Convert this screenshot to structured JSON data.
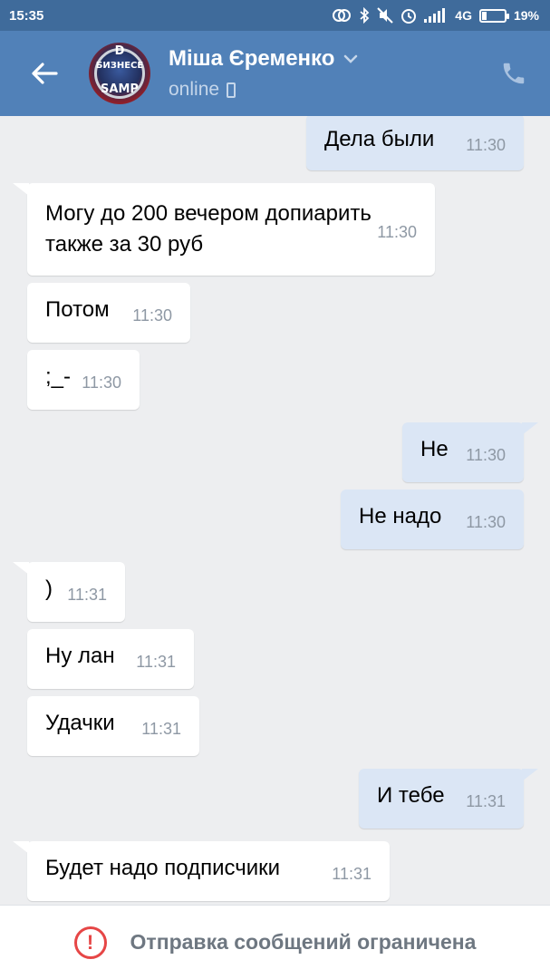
{
  "status_bar": {
    "time": "15:35",
    "network": "4G",
    "battery": "19%",
    "battery_level": 0.19,
    "icons": [
      "sync-icon",
      "bluetooth-icon",
      "mute-icon",
      "alarm-icon",
      "signal-icon",
      "battery-icon"
    ]
  },
  "header": {
    "contact_name": "Міша Єременко",
    "status": "online",
    "avatar_text_top": "D",
    "avatar_text_mid": "БИЗНЕСЕ",
    "avatar_text_bottom": "SAMP",
    "colors": {
      "header": "#5181b8",
      "status_bar": "#3f6b9b"
    }
  },
  "messages": [
    {
      "dir": "out",
      "text": "Дела были",
      "time": "11:30"
    },
    {
      "dir": "in",
      "text_lines": [
        "Могу до 200 вечером допиарить",
        "также за 30 руб"
      ],
      "time": "11:30",
      "tail": true
    },
    {
      "dir": "in",
      "text": "Потом",
      "time": "11:30"
    },
    {
      "dir": "in",
      "text": ";_-",
      "time": "11:30"
    },
    {
      "dir": "out",
      "text": "Не",
      "time": "11:30",
      "tail": true
    },
    {
      "dir": "out",
      "text": "Не надо",
      "time": "11:30"
    },
    {
      "dir": "in",
      "text": ")",
      "time": "11:31",
      "tail": true
    },
    {
      "dir": "in",
      "text": "Ну лан",
      "time": "11:31"
    },
    {
      "dir": "in",
      "text": "Удачки",
      "time": "11:31"
    },
    {
      "dir": "out",
      "text": "И тебе",
      "time": "11:31",
      "tail": true
    },
    {
      "dir": "in",
      "text": "Будет надо подписчики",
      "time": "11:31",
      "tail": true
    }
  ],
  "bottom_bar": {
    "icon": "exclamation-icon",
    "text": "Отправка сообщений ограничена",
    "accent": "#e64646"
  }
}
